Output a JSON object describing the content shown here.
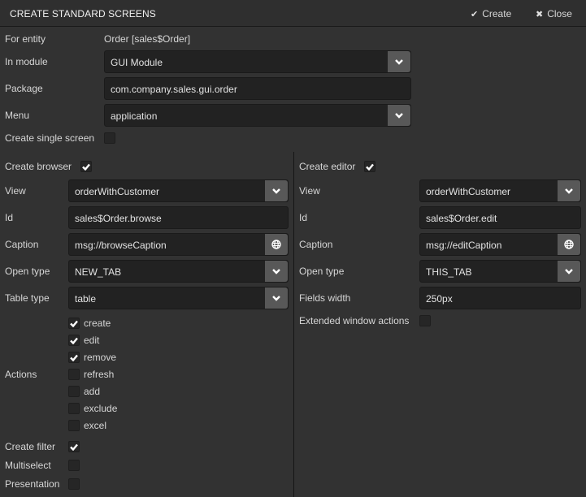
{
  "header": {
    "title": "CREATE STANDARD SCREENS",
    "create_label": "Create",
    "close_label": "Close"
  },
  "general": {
    "for_entity_label": "For entity",
    "for_entity_value": "Order [sales$Order]",
    "module_label": "In module",
    "module_value": "GUI Module",
    "package_label": "Package",
    "package_value": "com.company.sales.gui.order",
    "menu_label": "Menu",
    "menu_value": "application",
    "single_screen_label": "Create single screen",
    "single_screen_checked": false
  },
  "browser": {
    "create_label": "Create browser",
    "create_checked": true,
    "view_label": "View",
    "view_value": "orderWithCustomer",
    "id_label": "Id",
    "id_value": "sales$Order.browse",
    "caption_label": "Caption",
    "caption_value": "msg://browseCaption",
    "open_type_label": "Open type",
    "open_type_value": "NEW_TAB",
    "table_type_label": "Table type",
    "table_type_value": "table",
    "actions_label": "Actions",
    "actions": [
      {
        "label": "create",
        "checked": true
      },
      {
        "label": "edit",
        "checked": true
      },
      {
        "label": "remove",
        "checked": true
      },
      {
        "label": "refresh",
        "checked": false
      },
      {
        "label": "add",
        "checked": false
      },
      {
        "label": "exclude",
        "checked": false
      },
      {
        "label": "excel",
        "checked": false
      }
    ],
    "filter_label": "Create filter",
    "filter_checked": true,
    "multiselect_label": "Multiselect",
    "multiselect_checked": false,
    "presentation_label": "Presentation",
    "presentation_checked": false
  },
  "editor": {
    "create_label": "Create editor",
    "create_checked": true,
    "view_label": "View",
    "view_value": "orderWithCustomer",
    "id_label": "Id",
    "id_value": "sales$Order.edit",
    "caption_label": "Caption",
    "caption_value": "msg://editCaption",
    "open_type_label": "Open type",
    "open_type_value": "THIS_TAB",
    "fields_width_label": "Fields width",
    "fields_width_value": "250px",
    "extended_label": "Extended window actions",
    "extended_checked": false
  }
}
